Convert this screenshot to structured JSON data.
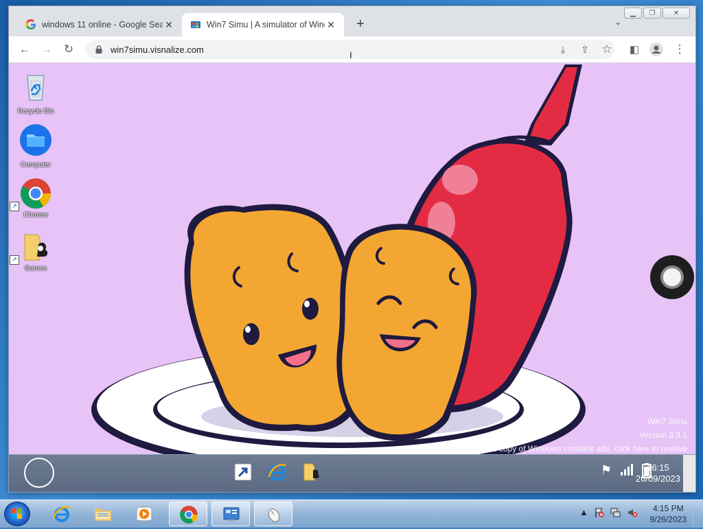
{
  "browser": {
    "tabs": [
      {
        "title": "windows 11 online - Google Sear",
        "favicon": "google-g-icon"
      },
      {
        "title": "Win7 Simu | A simulator of Windo",
        "favicon": "win7simu-icon"
      }
    ],
    "url": "win7simu.visnalize.com"
  },
  "sim_desktop": {
    "icons": [
      {
        "label": "Recycle Bin",
        "icon": "recycle-bin-icon"
      },
      {
        "label": "Computer",
        "icon": "folder-icon"
      },
      {
        "label": "Chrome",
        "icon": "chrome-icon"
      },
      {
        "label": "Games",
        "icon": "games-icon"
      }
    ],
    "watermark": {
      "line1": "Win7 Simu",
      "line2": "Version 3.3.1",
      "line3": "This copy of Windows contains ads, click here to resolve"
    },
    "taskbar": {
      "clock_time": "16:15",
      "clock_date": "26/09/2023"
    }
  },
  "host_taskbar": {
    "clock_time": "4:15 PM",
    "clock_date": "9/26/2023"
  },
  "colors": {
    "wallpaper": "#e7c3f7",
    "nugget": "#f3a732",
    "ketchup": "#e32c43",
    "outline": "#1f1a3f"
  }
}
